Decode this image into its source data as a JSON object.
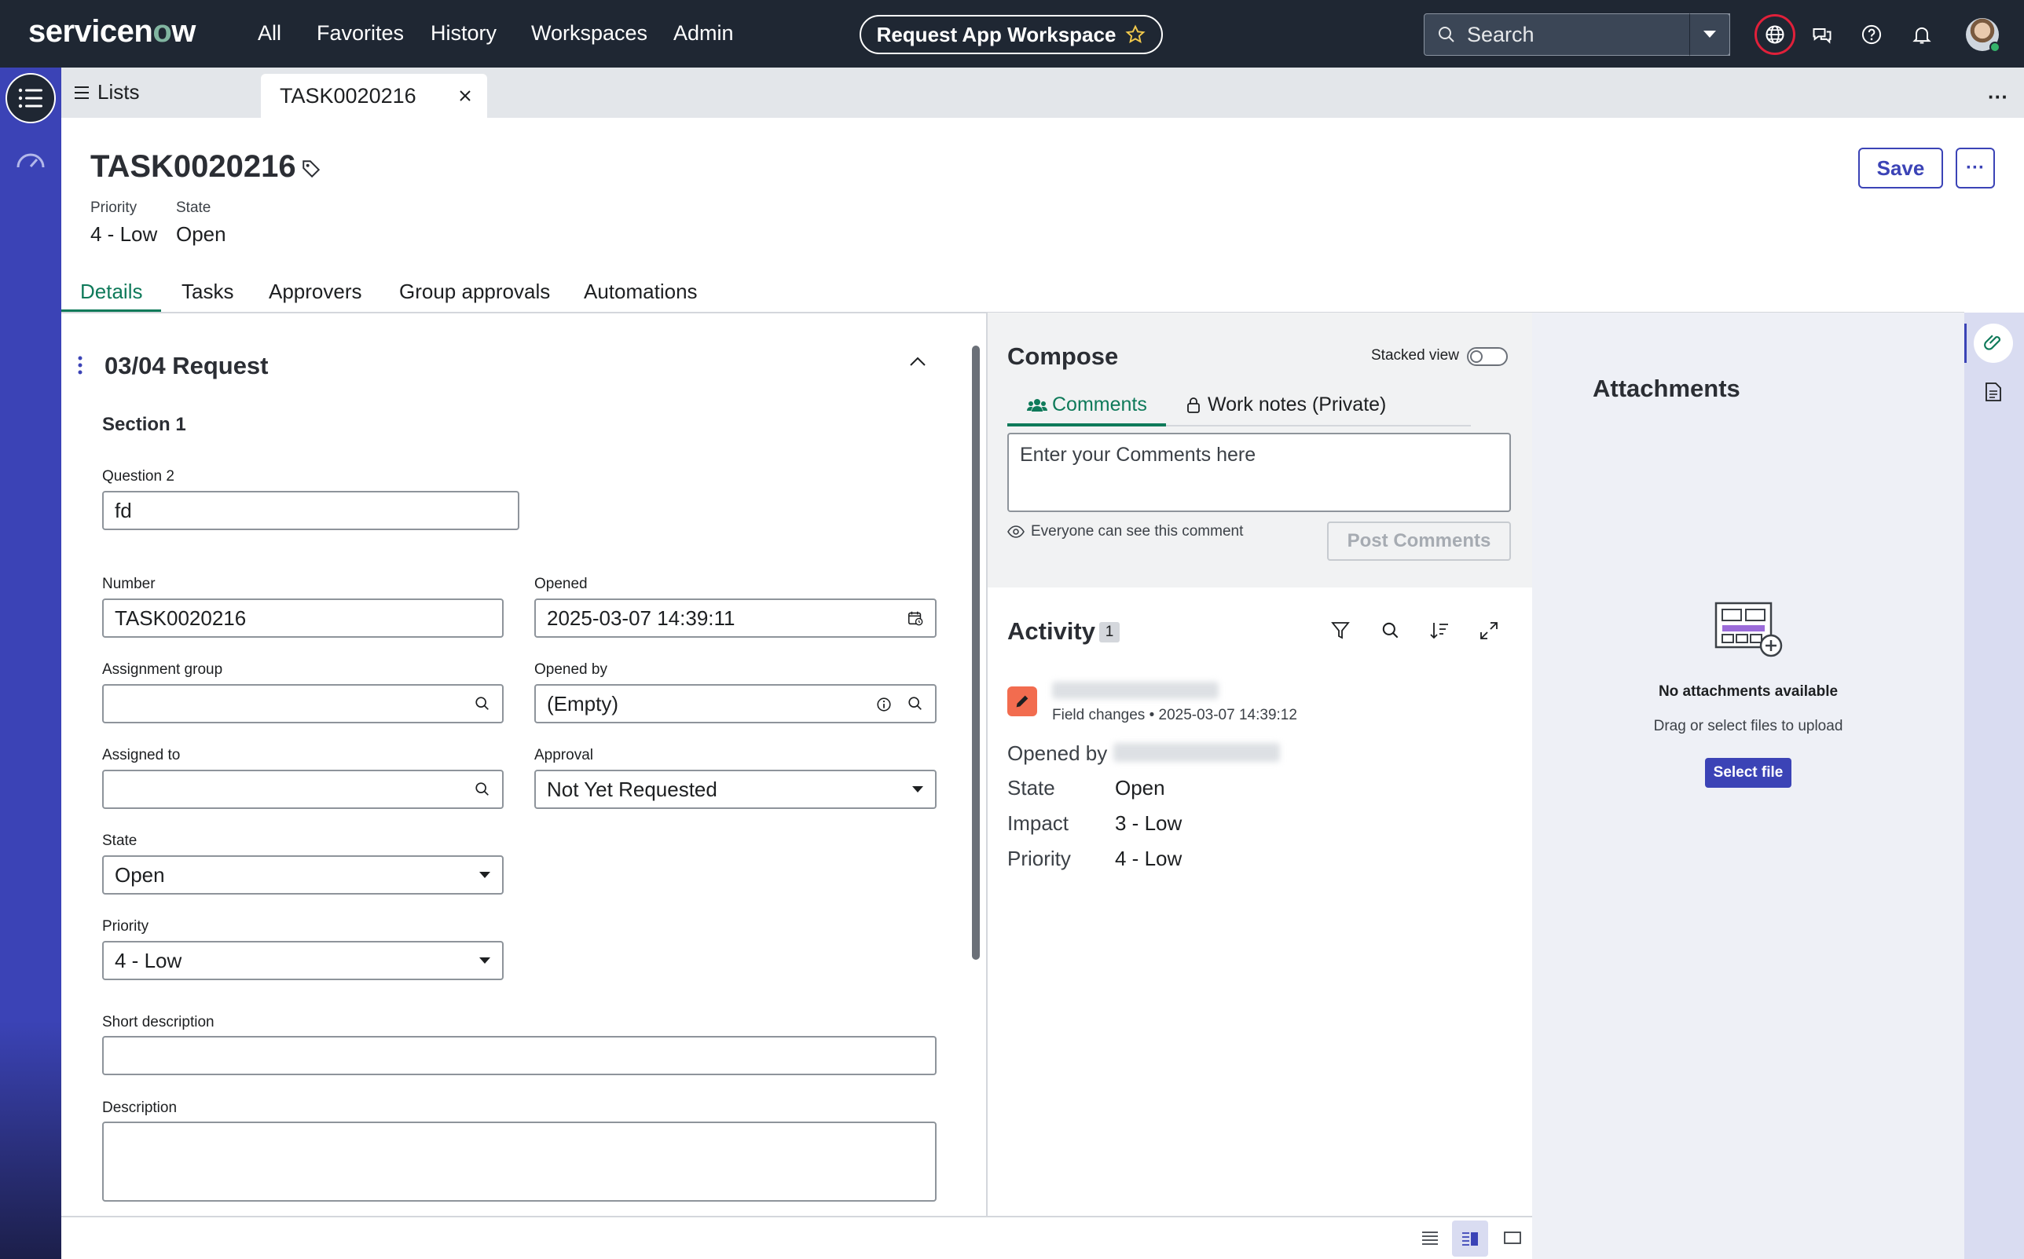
{
  "topnav": {
    "logo_text": "servicenow",
    "items": [
      "All",
      "Favorites",
      "History",
      "Workspaces",
      "Admin"
    ],
    "workspace_label": "Request App Workspace",
    "search_placeholder": "Search"
  },
  "tabbar": {
    "lists_label": "Lists",
    "active_tab": "TASK0020216"
  },
  "record": {
    "title": "TASK0020216",
    "priority_label": "Priority",
    "priority_value": "4 - Low",
    "state_label": "State",
    "state_value": "Open",
    "save_label": "Save",
    "more_label": "···"
  },
  "form_tabs": [
    "Details",
    "Tasks",
    "Approvers",
    "Group approvals",
    "Automations"
  ],
  "form": {
    "section_title": "03/04 Request",
    "subsection": "Section 1",
    "question2_label": "Question 2",
    "question2_value": "fd",
    "number_label": "Number",
    "number_value": "TASK0020216",
    "opened_label": "Opened",
    "opened_value": "2025-03-07 14:39:11",
    "assignment_group_label": "Assignment group",
    "assignment_group_value": "",
    "opened_by_label": "Opened by",
    "opened_by_value": "(Empty)",
    "assigned_to_label": "Assigned to",
    "assigned_to_value": "",
    "approval_label": "Approval",
    "approval_value": "Not Yet Requested",
    "state_label": "State",
    "state_value": "Open",
    "priority_label": "Priority",
    "priority_value": "4 - Low",
    "short_description_label": "Short description",
    "short_description_value": "",
    "description_label": "Description",
    "description_value": ""
  },
  "compose": {
    "title": "Compose",
    "stacked_view_label": "Stacked view",
    "comments_tab": "Comments",
    "work_notes_tab": "Work notes (Private)",
    "comment_placeholder": "Enter your Comments here",
    "visibility_note": "Everyone can see this comment",
    "post_button": "Post Comments"
  },
  "activity": {
    "title": "Activity",
    "count": "1",
    "entry_meta": "Field changes • 2025-03-07 14:39:12",
    "opened_by_label": "Opened by",
    "fields": [
      {
        "key": "State",
        "value": "Open"
      },
      {
        "key": "Impact",
        "value": "3 - Low"
      },
      {
        "key": "Priority",
        "value": "4 - Low"
      }
    ]
  },
  "attachments": {
    "title": "Attachments",
    "empty_text": "No attachments available",
    "hint": "Drag or select files to upload",
    "select_button": "Select file"
  },
  "colors": {
    "nav_bg": "#1f2733",
    "accent": "#3b43b6",
    "active_tab": "#0f7a5a",
    "activity_icon": "#f26c4f"
  }
}
